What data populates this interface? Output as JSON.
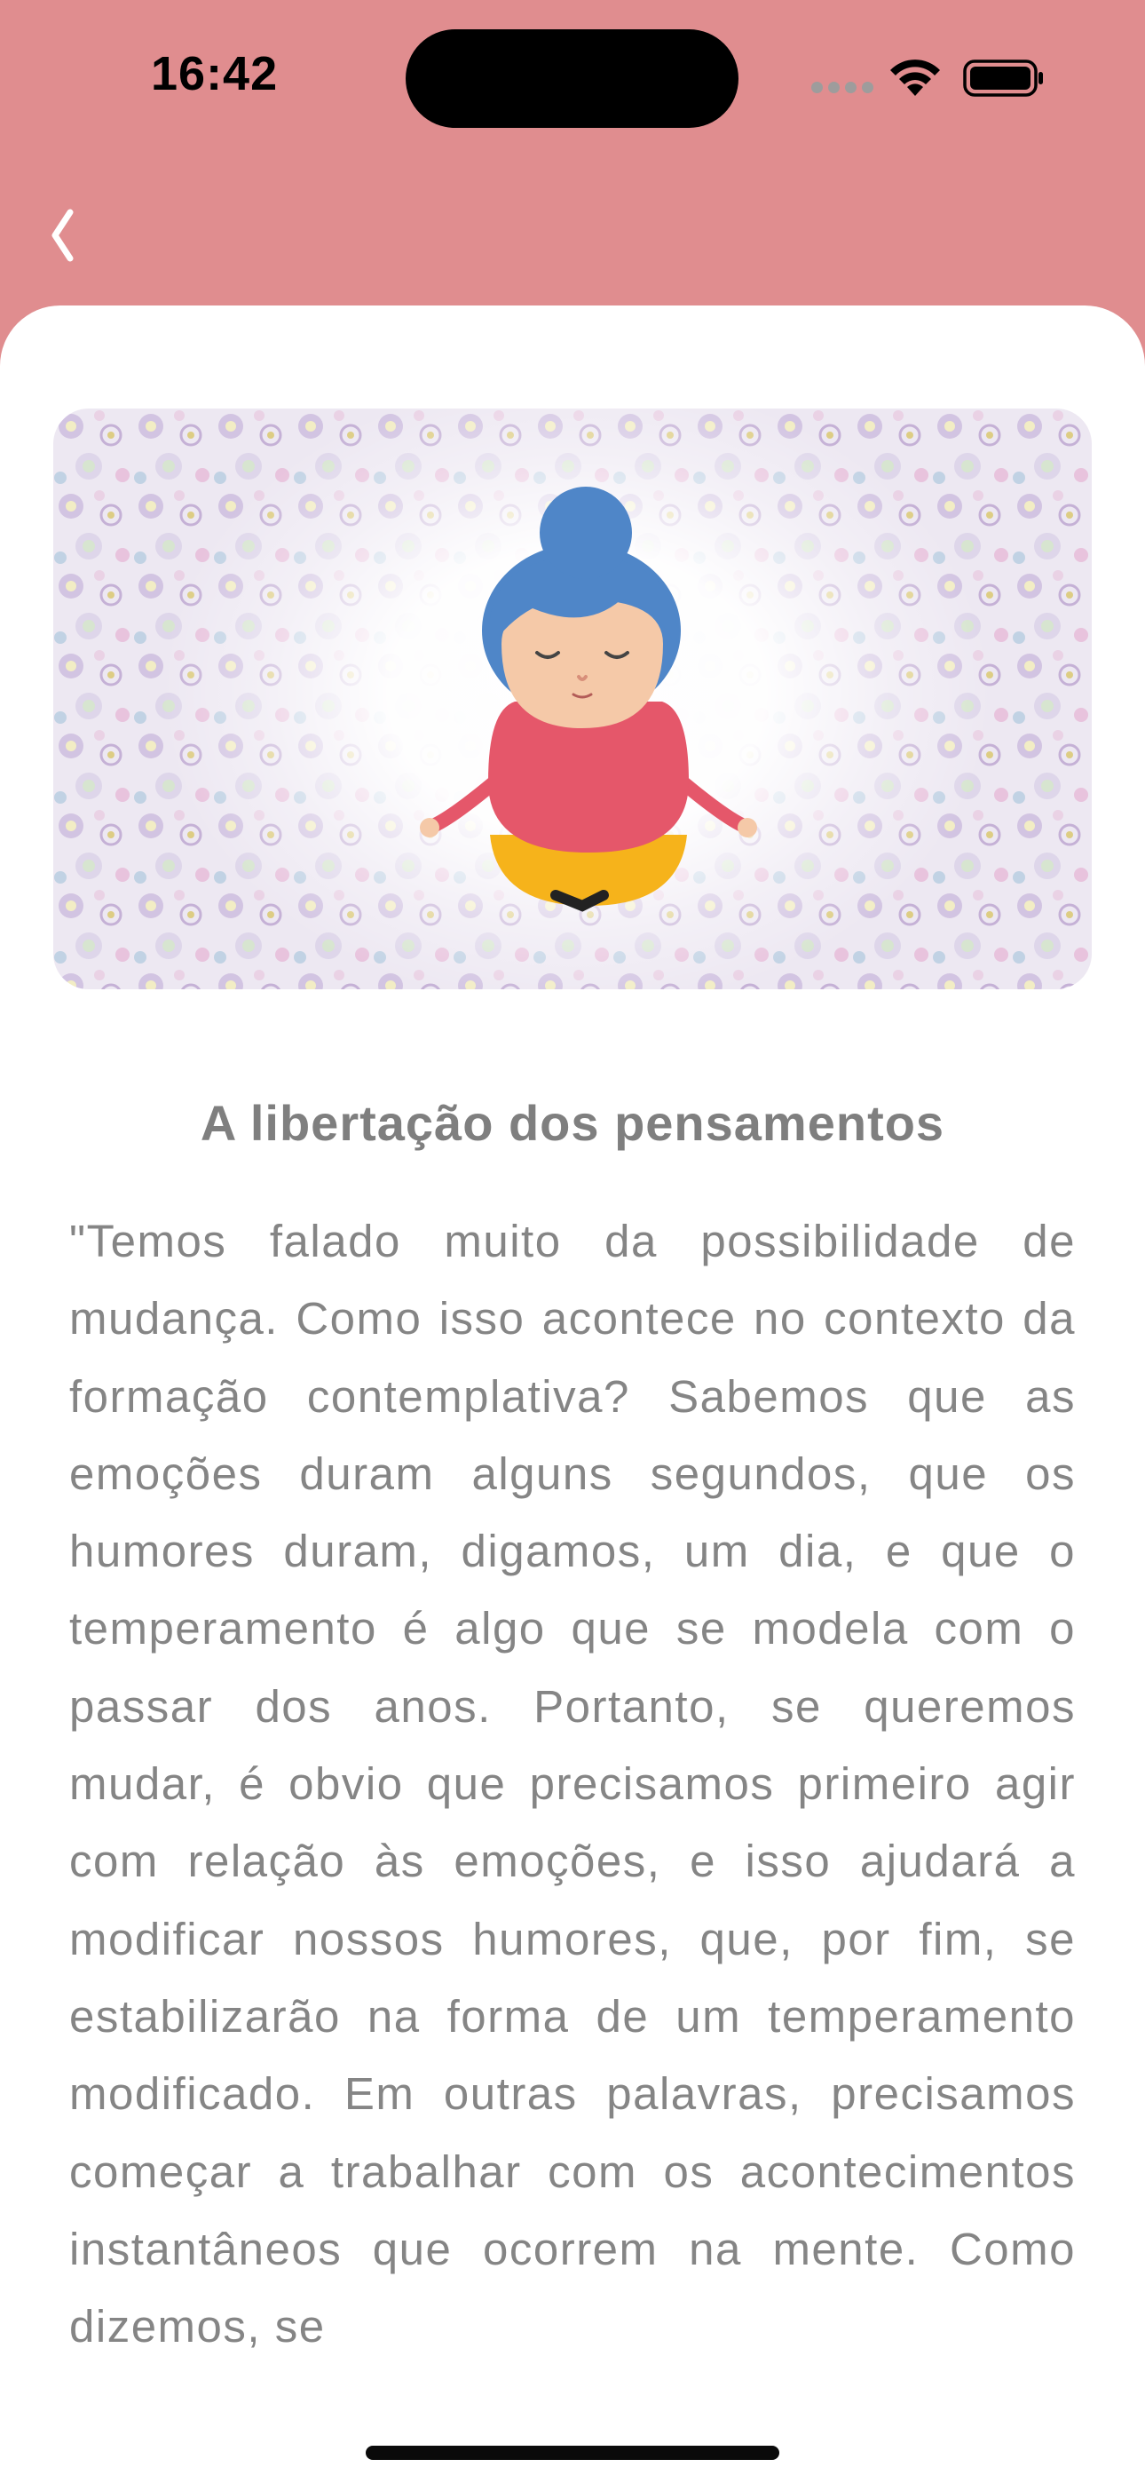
{
  "status_bar": {
    "time": "16:42"
  },
  "nav": {
    "back_icon": "chevron-left-icon"
  },
  "article": {
    "image_icon": "meditating-woman-illustration",
    "title": "A libertação dos pensamentos",
    "body": "\"Temos falado muito da possibilidade de mudança. Como isso acontece no contexto da formação contemplativa? Sabemos que as emoções duram alguns segundos, que os humores duram, digamos, um dia, e que o temperamento é algo que se modela com o passar dos anos. Portanto, se queremos mudar, é obvio que precisamos primeiro agir com relação às emoções, e isso ajudará a modificar nossos humores, que, por fim, se estabilizarão na forma de um temperamento modificado. Em outras palavras, precisamos começar a trabalhar com os acontecimentos instantâneos que ocorrem na mente. Como dizemos, se"
  },
  "colors": {
    "header_background": "#e08d8f",
    "sheet_background": "#ffffff",
    "title_text": "#7f7f7f",
    "body_text": "#858585"
  }
}
